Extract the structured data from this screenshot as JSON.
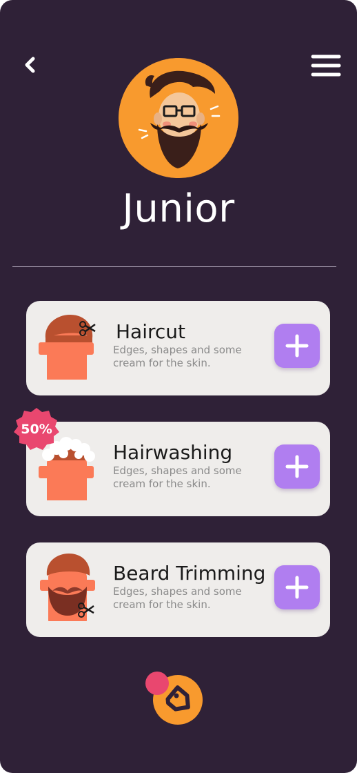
{
  "profile": {
    "name": "Junior",
    "avatar_icon": "bearded-man-avatar-icon"
  },
  "header": {
    "back_icon": "chevron-left-icon",
    "menu_icon": "hamburger-menu-icon"
  },
  "services": [
    {
      "title": "Haircut",
      "description": "Edges, shapes and some cream for the skin.",
      "icon": "haircut-icon",
      "action_icon": "plus-icon"
    },
    {
      "title": "Hairwashing",
      "description": "Edges, shapes and some cream for the skin.",
      "icon": "hairwashing-icon",
      "action_icon": "plus-icon",
      "badge": "50%"
    },
    {
      "title": "Beard Trimming",
      "description": "Edges, shapes and some cream for the skin.",
      "icon": "beard-trimming-icon",
      "action_icon": "plus-icon"
    }
  ],
  "bottom_action": {
    "icon": "price-tag-icon"
  },
  "colors": {
    "background": "#2f2137",
    "card": "#efedeb",
    "accent_purple": "#b07ef0",
    "accent_orange": "#f89a2e",
    "badge_pink": "#e9476f",
    "illustration_orange": "#fb7a57"
  }
}
